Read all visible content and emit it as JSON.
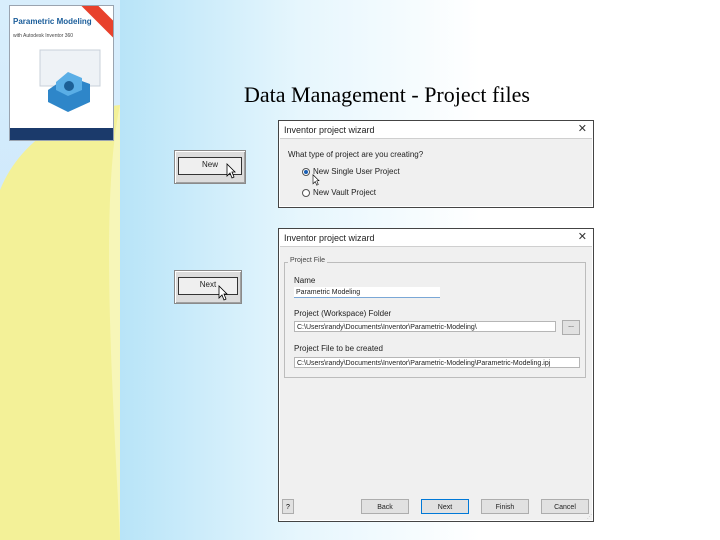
{
  "slide": {
    "title": "Data Management - Project files"
  },
  "book": {
    "title": "Parametric Modeling",
    "subtitle": "with Autodesk Inventor 360"
  },
  "mock_buttons": {
    "new_label": "New",
    "next_label": "Next"
  },
  "wizard_type": {
    "title": "Inventor project wizard",
    "question": "What type of project are you creating?",
    "options": [
      {
        "label": "New Single User Project",
        "selected": true
      },
      {
        "label": "New Vault Project",
        "selected": false
      }
    ]
  },
  "wizard_file": {
    "title": "Inventor project wizard",
    "group_label": "Project File",
    "name_label": "Name",
    "name_value": "Parametric Modeling",
    "folder_label": "Project (Workspace) Folder",
    "folder_value": "C:\\Users\\randy\\Documents\\Inventor\\Parametric-Modeling\\",
    "browse_label": "...",
    "file_label": "Project File to be created",
    "file_value": "C:\\Users\\randy\\Documents\\Inventor\\Parametric-Modeling\\Parametric-Modeling.ipj",
    "help_label": "?",
    "back_label": "Back",
    "next_label": "Next",
    "finish_label": "Finish",
    "cancel_label": "Cancel"
  },
  "colors": {
    "accent": "#0078d7",
    "band": "#cde8fb",
    "swoosh": "#f4f29a"
  },
  "icons": [
    "close-icon",
    "pointer-cursor-icon",
    "size-grip-icon"
  ]
}
